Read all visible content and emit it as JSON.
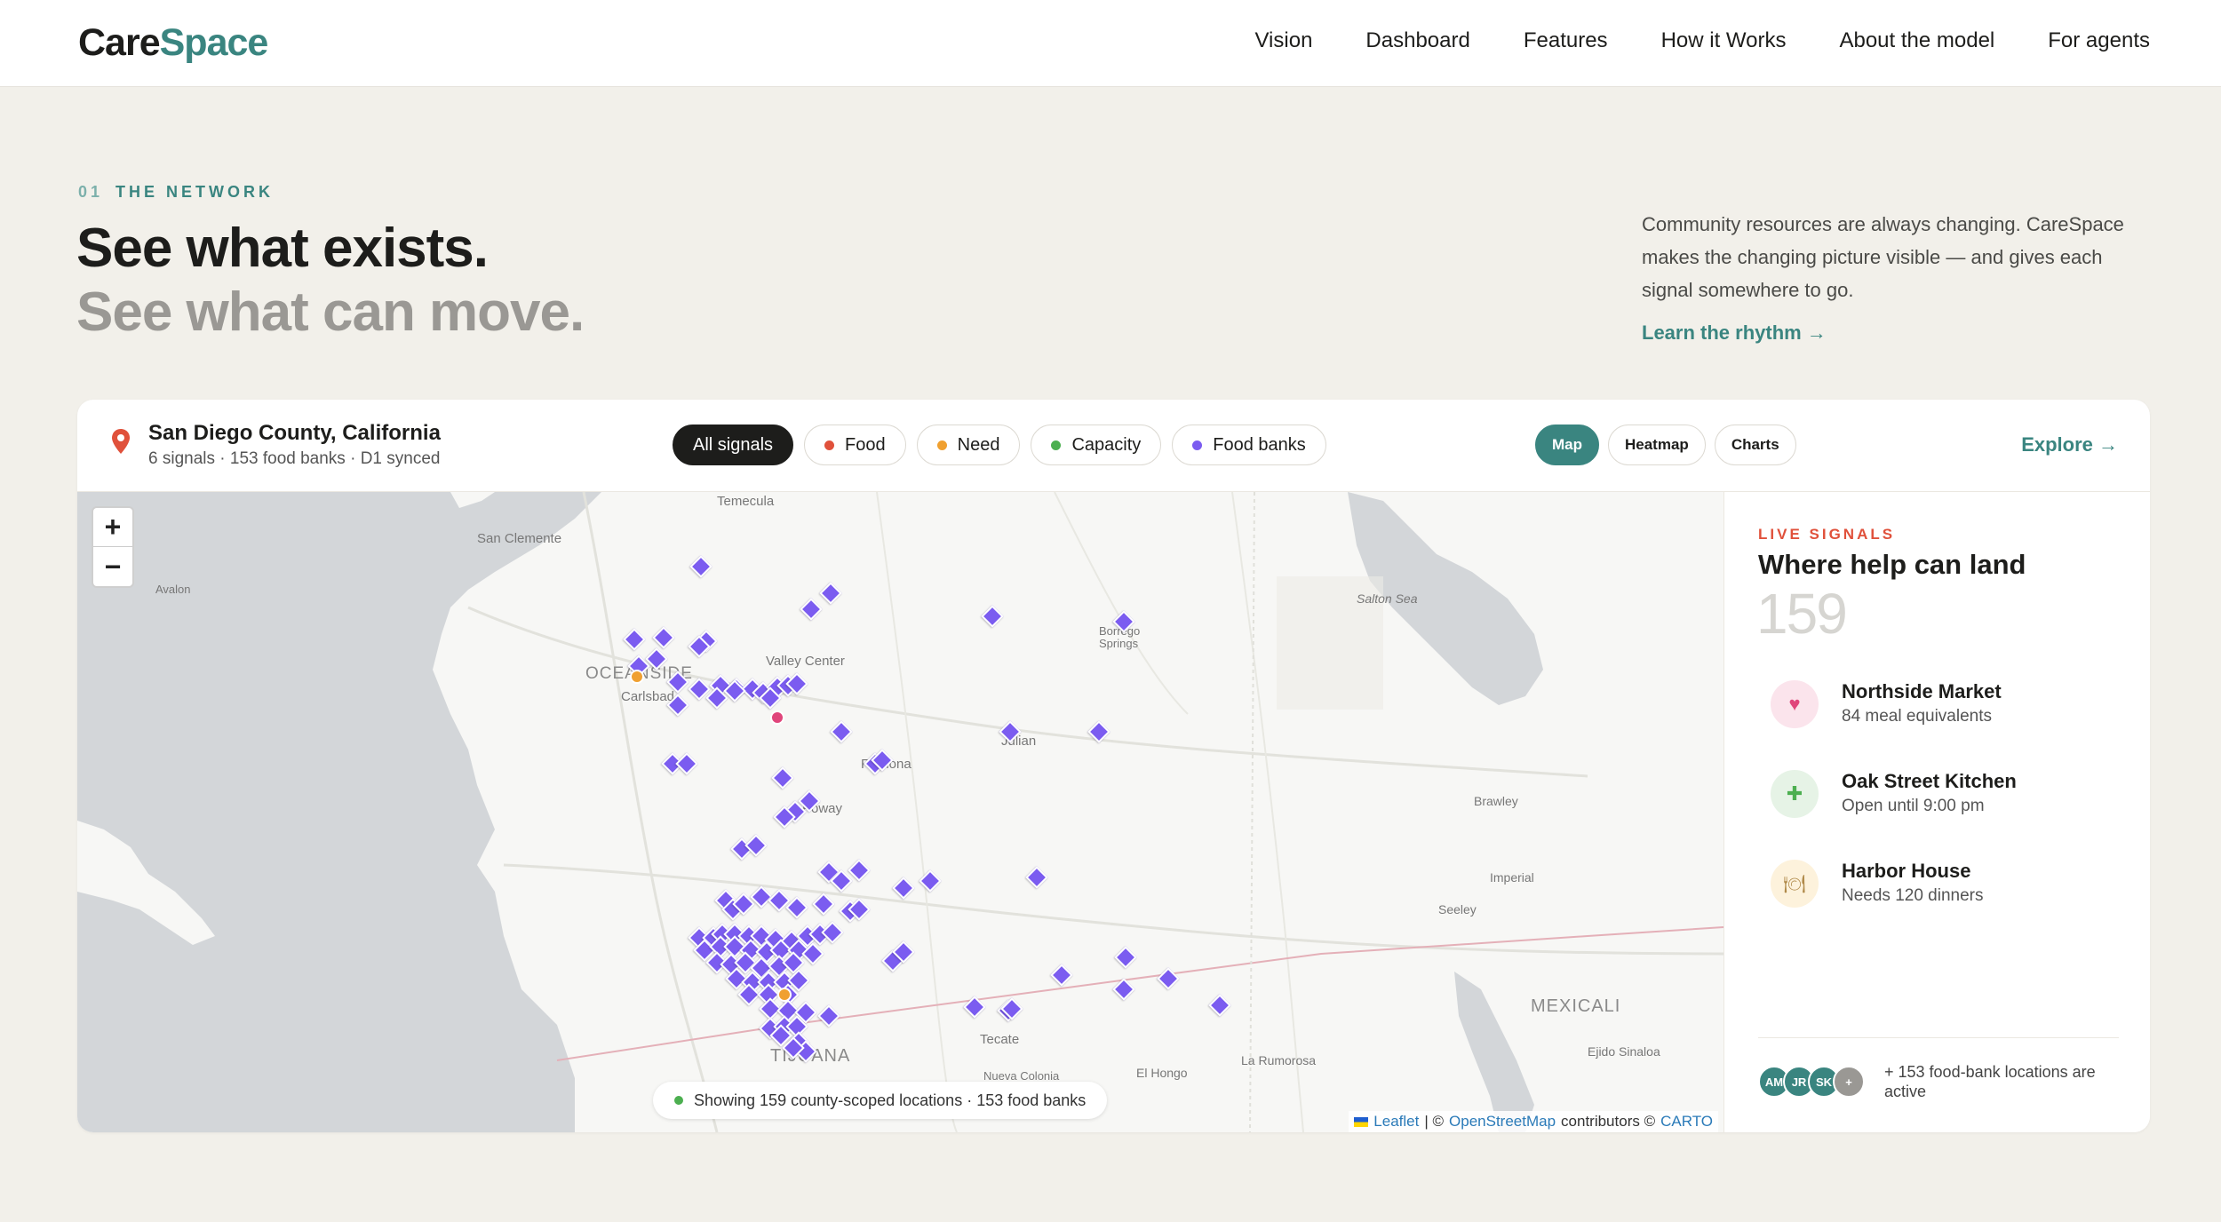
{
  "brand": {
    "part1": "Care",
    "part2": "Space"
  },
  "nav": {
    "items": [
      "Vision",
      "Dashboard",
      "Features",
      "How it Works",
      "About the model",
      "For agents"
    ]
  },
  "hero": {
    "eyebrow_num": "01",
    "eyebrow_label": "THE NETWORK",
    "headline_1": "See what exists.",
    "headline_2": "See what can move.",
    "intro": "Community resources are always changing. CareSpace makes the changing picture visible — and gives each signal somewhere to go.",
    "cta": "Learn the rhythm →"
  },
  "card": {
    "location": "San Diego County, California",
    "location_sub": "6 signals · 153 food banks · D1 synced",
    "filters": [
      {
        "label": "All signals",
        "color": ""
      },
      {
        "label": "Food",
        "color": "#e0513b"
      },
      {
        "label": "Need",
        "color": "#f0a030"
      },
      {
        "label": "Capacity",
        "color": "#4caf50"
      },
      {
        "label": "Food banks",
        "color": "#7b5cf0"
      }
    ],
    "views": [
      "Map",
      "Heatmap",
      "Charts"
    ],
    "explore": "Explore →"
  },
  "map": {
    "zoom_in": "+",
    "zoom_out": "−",
    "labels": {
      "temecula": "Temecula",
      "san_clemente": "San Clemente",
      "avalon": "Avalon",
      "oceanside": "OCEANSIDE",
      "carlsbad": "Carlsbad",
      "valley_center": "Valley Center",
      "borrego": "Borrego Springs",
      "salton": "Salton Sea",
      "ramona": "Ramona",
      "julian": "Julian",
      "poway": "Poway",
      "brawley": "Brawley",
      "imperial": "Imperial",
      "seeley": "Seeley",
      "mexicali": "MEXICALI",
      "ejido": "Ejido Sinaloa",
      "tecate": "Tecate",
      "nueva_colonia": "Nueva Colonia",
      "el_hongo": "El Hongo",
      "la_rumorosa": "La Rumorosa",
      "tijuana": "TIJUANA"
    },
    "status": "Showing 159 county-scoped locations · 153 food banks",
    "attribution": {
      "leaflet": "Leaflet",
      "sep": "| ©",
      "osm": "OpenStreetMap",
      "contrib": "contributors ©",
      "carto": "CARTO"
    },
    "marker_color": "#7b5cf0"
  },
  "side": {
    "eyebrow": "LIVE SIGNALS",
    "title": "Where help can land",
    "count": "159",
    "signals": [
      {
        "name": "Northside Market",
        "detail": "84 meal equivalents",
        "icon": "heart-icon",
        "glyph": "♥",
        "bg": "#fbe4ec",
        "fg": "#e0457b"
      },
      {
        "name": "Oak Street Kitchen",
        "detail": "Open until 9:00 pm",
        "icon": "plus-icon",
        "glyph": "✚",
        "bg": "#e6f3e6",
        "fg": "#4caf50"
      },
      {
        "name": "Harbor House",
        "detail": "Needs 120 dinners",
        "icon": "plate-icon",
        "glyph": "🍽",
        "bg": "#fdf2dc",
        "fg": "#b08a4a"
      }
    ],
    "avatars": [
      {
        "initials": "AM",
        "color": "#3a8580"
      },
      {
        "initials": "JR",
        "color": "#3a8580"
      },
      {
        "initials": "SK",
        "color": "#3a8580"
      },
      {
        "initials": "+",
        "color": "#9a9894"
      }
    ],
    "footer": "+ 153 food-bank locations are active"
  }
}
